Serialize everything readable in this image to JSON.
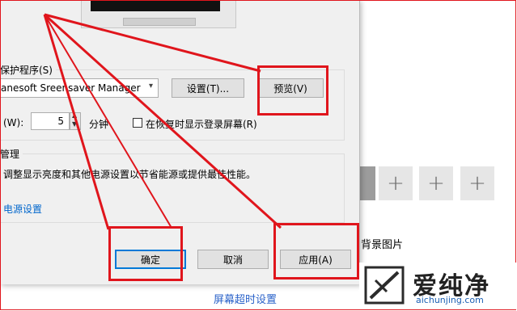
{
  "dialog": {
    "screensaver_group_label": "保护程序(S)",
    "screensaver_selected": "anesoft Sreensaver Manager",
    "settings_button": "设置(T)...",
    "preview_button": "预览(V)",
    "wait_label": "(W):",
    "wait_value": "5",
    "wait_unit": "分钟",
    "resume_checkbox_label": "在恢复时显示登录屏幕(R)",
    "resume_checked": false,
    "power_group_label": "管理",
    "power_description": "调整显示亮度和其他电源设置以节省能源或提供最佳性能。",
    "power_link": "电源设置",
    "ok_button": "确定",
    "cancel_button": "取消",
    "apply_button": "应用(A)"
  },
  "settings_page": {
    "background_image_label": "背景图片",
    "screen_timeout_link": "屏幕超时设置",
    "add_tile_glyph": "+"
  },
  "watermark": {
    "brand": "爱纯净",
    "url": "aichunjing.com"
  },
  "annotation_color": "#e0151c"
}
